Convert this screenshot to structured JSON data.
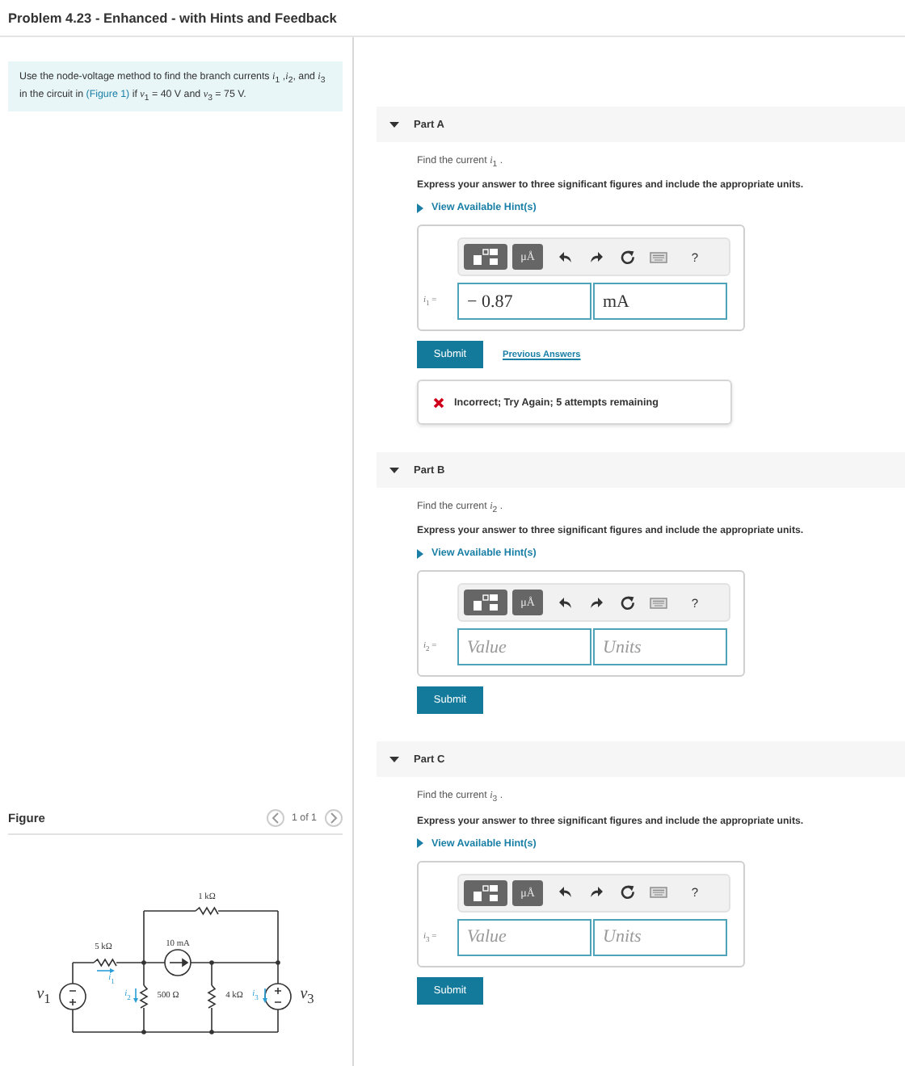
{
  "header": {
    "title": "Problem 4.23 - Enhanced - with Hints and Feedback"
  },
  "intro": {
    "before": "Use the node-voltage method to find the branch currents *i*$_{1}$ ,*i*$_{2}$, and *i*$_{3}$ in the circuit in ",
    "link": "(Figure 1)",
    "after": " if *v*$_{1}$ = 40 V and *v*$_{3}$ = 75 V."
  },
  "figure": {
    "title": "Figure",
    "pager": "1 of 1",
    "labels": [
      {
        "text": "1 kΩ"
      },
      {
        "text": "5 kΩ"
      },
      {
        "text": "10 mA"
      },
      {
        "text": "*i*$_{1}$",
        "kind": "current"
      },
      {
        "text": "*v*$_{1}$",
        "kind": "source"
      },
      {
        "text": "*i*$_{2}$",
        "kind": "current"
      },
      {
        "text": "500 Ω"
      },
      {
        "text": "4 kΩ"
      },
      {
        "text": "*i*$_{3}$",
        "kind": "current"
      },
      {
        "text": "*v*$_{3}$",
        "kind": "source"
      }
    ]
  },
  "parts": [
    {
      "title": "Part A",
      "expanded": true,
      "prompt": "Find the current *i*$_{1}$ .",
      "instruction": "Express your answer to three significant figures and include the appropriate units.",
      "hint": "View Available Hint(s)",
      "toolbar": {
        "units": "μÅ",
        "help": "?"
      },
      "variable": "*i*$_{1}$ =",
      "value_field": {
        "value": "− 0.87"
      },
      "unit_field": {
        "value": "mA"
      },
      "submit": "Submit",
      "previous": "Previous Answers",
      "feedback": {
        "kind": "incorrect",
        "text": "Incorrect; Try Again; 5 attempts remaining"
      }
    },
    {
      "title": "Part B",
      "expanded": true,
      "prompt": "Find the current *i*$_{2}$ .",
      "instruction": "Express your answer to three significant figures and include the appropriate units.",
      "hint": "View Available Hint(s)",
      "toolbar": {
        "units": "μÅ",
        "help": "?"
      },
      "variable": "*i*$_{2}$ =",
      "value_field": {
        "placeholder": "Value"
      },
      "unit_field": {
        "placeholder": "Units"
      },
      "submit": "Submit"
    },
    {
      "title": "Part C",
      "expanded": true,
      "prompt": "Find the current *i*$_{3}$ .",
      "instruction": "Express your answer to three significant figures and include the appropriate units.",
      "hint": "View Available Hint(s)",
      "toolbar": {
        "units": "μÅ",
        "help": "?"
      },
      "variable": "*i*$_{3}$ =",
      "value_field": {
        "placeholder": "Value"
      },
      "unit_field": {
        "placeholder": "Units"
      },
      "submit": "Submit"
    }
  ]
}
